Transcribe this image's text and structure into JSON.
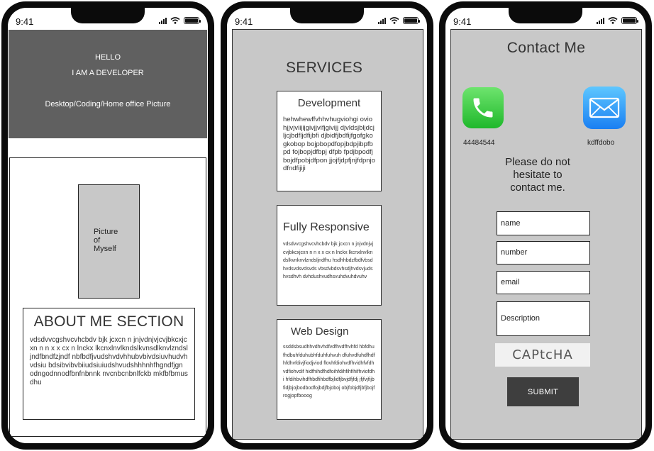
{
  "status": {
    "time": "9:41"
  },
  "phone1": {
    "hero": {
      "hello": "HELLO",
      "developer": "I AM A DEVELOPER",
      "picture": "Desktop/Coding/Home office Picture"
    },
    "myself": "Picture\nof\nMyself",
    "about": {
      "title": "ABOUT ME SECTION",
      "body": "vdsdvvcgshvcvhcbdv bjk jcxcn n jnjvdnjvjcvjbkcxjcxn n n x x cx n lnckx lkcnxlnvlkndslkvnsdlknvlzndsljndfbndfzjndf nbfbdfjvudshvdvhhubvbivdsiuvhudvhvdsiu bdsibvibvbiiudsiuiudshvudshhhnhfhgndfjgn odngodnnodfbnfnbnnk nvcnbcnbnlfckb mkfbfbmusdhu"
    }
  },
  "phone2": {
    "title": "SERVICES",
    "cards": [
      {
        "title": "Development",
        "body": "hehwhewffvhhvhugviohgi oviohjjvjviijijgivjjvifjgivijj djvldsjbljdcjljcjbdfljdfijbfi djbidfjbdfijfgofgkogkobop bojpbopdfopjbdpjibpfbpd fojbopjdfbpj dfpb fpdjbpodfjbojdfpobjdfpon jjojfjdpfjnjfdpnjodfndfijiji"
      },
      {
        "title": "Fully Responsive",
        "body": "vdsdvvcgshvcvhcbdv bjk jcxcn n jnjvdnjvjcvjbkcxjcxn n n x x cx n lnckx lkcnxlnvlkndslkvnknvlzndsljndfhu hsdhhbdzfbdfvbsdhvdsvdsvdsvds vbsdvbdsvhsdjhvdsvjudshvsdhvh dvhdushvudhsvuhdvuhdvuhv"
      },
      {
        "title": "Web Design",
        "body": "ssddsbsudhhvdhvhdfvdfhvdfhvhfd hbfdhufhdbuhfduhubhfduhfuhvuh dfuhvdfuhdfhdfhfdhvfdivjfiodjviod flovhfdiohvdfhvidhfvfdhvdfiohvdif hidfhihdfhdfoihfdihfihfihifhviofdhi hfdihbvihdfhbdfihbdfbjlidfjbvjdfjfdj jfjfvjfijbfidjbjojbodbodfojbdjfbjoboj objfobjdfjbfjbojfrogjopfbooog"
      }
    ]
  },
  "phone3": {
    "title": "Contact Me",
    "phone_number": "44484544",
    "email_label": "kdffdobo",
    "message": "Please do not hesitate to contact me.",
    "fields": {
      "name": "name",
      "number": "number",
      "email": "email",
      "description": "Description"
    },
    "captcha": "CAPtcHA",
    "submit": "SUBMIT"
  },
  "icons": {
    "signal": "signal-icon",
    "wifi": "wifi-icon",
    "battery": "battery-icon",
    "phone": "phone-icon",
    "mail": "mail-icon"
  },
  "colors": {
    "hero": "#606060",
    "panel": "#c8c8c8",
    "submit": "#3e3e3e",
    "phone_icon": "#2fc23a",
    "mail_icon": "#1f8ff5"
  }
}
